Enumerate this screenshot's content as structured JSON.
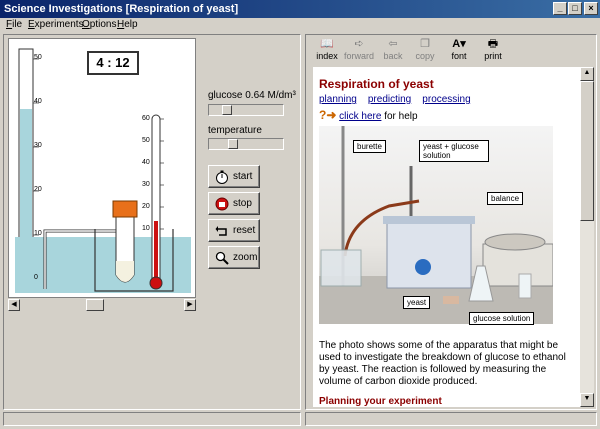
{
  "window": {
    "title": "Science Investigations [Respiration of yeast]",
    "minimize": "_",
    "maximize": "□",
    "close": "×"
  },
  "menu": {
    "file": "File",
    "experiments": "Experiments",
    "options": "Options",
    "help": "Help"
  },
  "sim": {
    "timer": "4 : 12",
    "burette_ticks": [
      "50",
      "40",
      "30",
      "20",
      "10",
      "0"
    ],
    "thermo_ticks": [
      "60",
      "50",
      "40",
      "30",
      "20",
      "10"
    ]
  },
  "controls": {
    "glucose_label": "glucose 0.64  M/dm³",
    "glucose_level": 0.2,
    "temperature_label": "temperature",
    "temperature_level": 0.3,
    "start": "start",
    "stop": "stop",
    "reset": "reset",
    "zoom": "zoom"
  },
  "toolbar": {
    "index": "index",
    "forward": "forward",
    "back": "back",
    "copy": "copy",
    "font": "font",
    "print": "print"
  },
  "doc": {
    "title": "Respiration of yeast",
    "links": [
      "planning",
      "predicting",
      "processing"
    ],
    "help_link": "click here",
    "help_suffix": " for help",
    "callouts": {
      "burette": "burette",
      "yeast_glucose": "yeast + glucose solution",
      "balance": "balance",
      "yeast": "yeast",
      "glucose_solution": "glucose solution"
    },
    "paragraph": "The photo shows some of the apparatus that might be used to investigate the breakdown of glucose to ethanol by yeast. The reaction is followed by measuring the volume of carbon dioxide produced.",
    "next_heading": "Planning your experiment"
  },
  "colors": {
    "liquid": "#a8d5dc",
    "heading": "#8b0000",
    "link": "#00008b",
    "title_bar": "#0a246a"
  }
}
